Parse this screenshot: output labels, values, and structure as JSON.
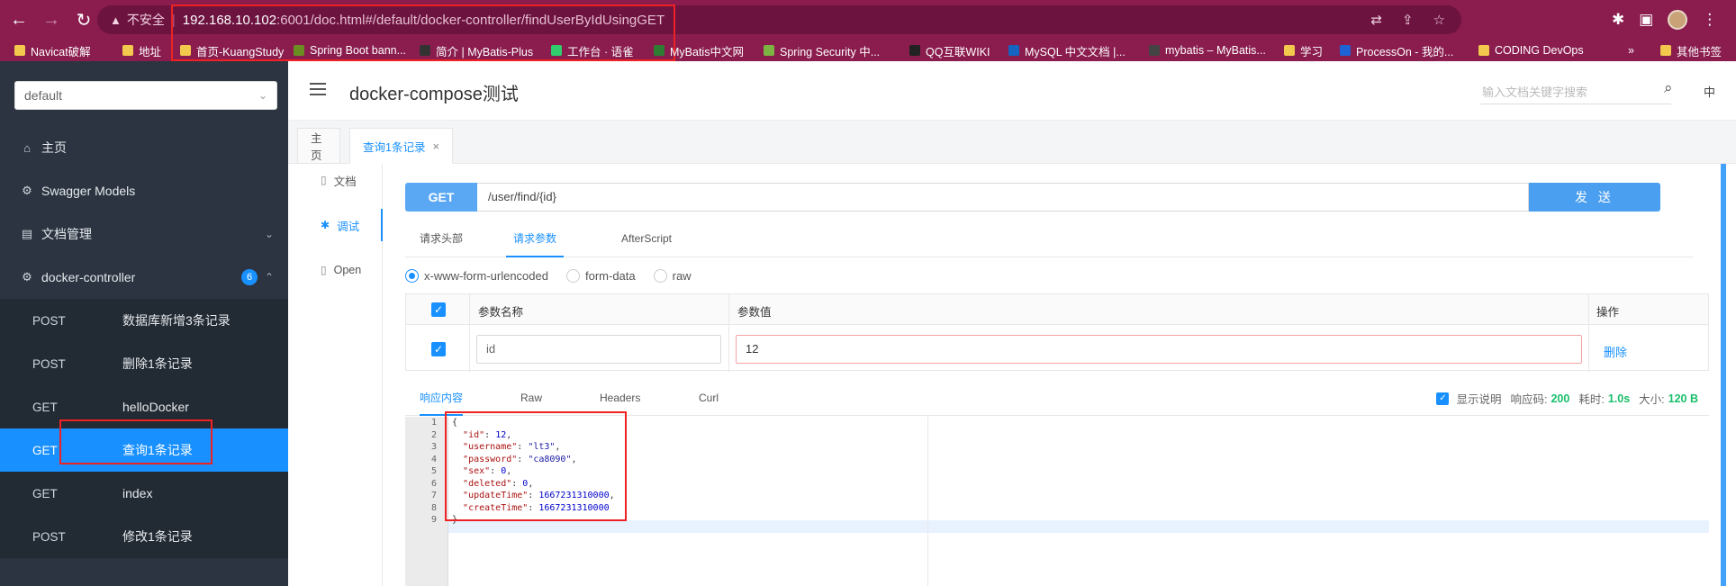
{
  "browser": {
    "insecure_label": "不安全",
    "url_host": "192.168.10.102",
    "url_rest": ":6001/doc.html#/default/docker-controller/findUserByIdUsingGET",
    "bookmarks": [
      {
        "label": "Navicat破解",
        "color": "#f2c94c"
      },
      {
        "label": "地址",
        "color": "#f2c94c"
      },
      {
        "label": "首页-KuangStudy",
        "color": "#f2c94c"
      },
      {
        "label": "Spring Boot bann...",
        "color": "#6b8e23"
      },
      {
        "label": "简介 | MyBatis-Plus",
        "color": "#333333"
      },
      {
        "label": "工作台 · 语雀",
        "color": "#31cc6b"
      },
      {
        "label": "MyBatis中文网",
        "color": "#2e7d32"
      },
      {
        "label": "Spring Security 中...",
        "color": "#7cb342"
      },
      {
        "label": "QQ互联WIKI",
        "color": "#222222"
      },
      {
        "label": "MySQL 中文文档 |...",
        "color": "#1565c0"
      },
      {
        "label": "mybatis – MyBatis...",
        "color": "#444444"
      },
      {
        "label": "学习",
        "color": "#f2c94c"
      },
      {
        "label": "ProcessOn - 我的...",
        "color": "#1e63d6"
      },
      {
        "label": "CODING DevOps",
        "color": "#f2c94c"
      }
    ],
    "more_bookmarks": "»",
    "other_bookmarks": "其他书签"
  },
  "sidebar": {
    "group_select": "default",
    "items": [
      {
        "icon": "home-icon",
        "glyph": "⌂",
        "label": "主页"
      },
      {
        "icon": "swagger-models-icon",
        "glyph": "⚙",
        "label": "Swagger Models"
      },
      {
        "icon": "doc-manage-icon",
        "glyph": "▤",
        "label": "文档管理",
        "chevron": "⌄"
      },
      {
        "icon": "controller-icon",
        "glyph": "⚙",
        "label": "docker-controller",
        "badge": "6",
        "chevron": "⌃"
      }
    ],
    "endpoints": [
      {
        "method": "POST",
        "label": "数据库新增3条记录"
      },
      {
        "method": "POST",
        "label": "删除1条记录"
      },
      {
        "method": "GET",
        "label": "helloDocker"
      },
      {
        "method": "GET",
        "label": "查询1条记录"
      },
      {
        "method": "GET",
        "label": "index"
      },
      {
        "method": "POST",
        "label": "修改1条记录"
      }
    ]
  },
  "header": {
    "title": "docker-compose测试",
    "search_placeholder": "输入文档关键字搜索",
    "lang": "中"
  },
  "tabs": [
    {
      "label": "主页"
    },
    {
      "label": "查询1条记录",
      "close": "×"
    }
  ],
  "vtabs": [
    {
      "glyph": "▯",
      "label": "文档"
    },
    {
      "glyph": "✱",
      "label": "调试"
    },
    {
      "glyph": "▯",
      "label": "Open"
    }
  ],
  "request": {
    "method": "GET",
    "url": "/user/find/{id}",
    "send": "发 送",
    "subtabs": [
      "请求头部",
      "请求参数",
      "AfterScript"
    ],
    "content_types": [
      "x-www-form-urlencoded",
      "form-data",
      "raw"
    ],
    "table_headers": {
      "name": "参数名称",
      "value": "参数值",
      "op": "操作"
    },
    "param": {
      "name": "id",
      "value": "12",
      "delete": "删除"
    }
  },
  "response": {
    "tabs": [
      "响应内容",
      "Raw",
      "Headers",
      "Curl"
    ],
    "show_desc": "显示说明",
    "code_label": "响应码:",
    "code": "200",
    "time_label": "耗时:",
    "time": "1.0s",
    "size_label": "大小:",
    "size": "120 B",
    "line_numbers": [
      "1",
      "2",
      "3",
      "4",
      "5",
      "6",
      "7",
      "8",
      "9"
    ],
    "body": {
      "id": "12",
      "username": "\"lt3\"",
      "password": "\"ca8090\"",
      "sex": "0",
      "deleted": "0",
      "updateTime": "1667231310000",
      "createTime": "1667231310000"
    }
  }
}
